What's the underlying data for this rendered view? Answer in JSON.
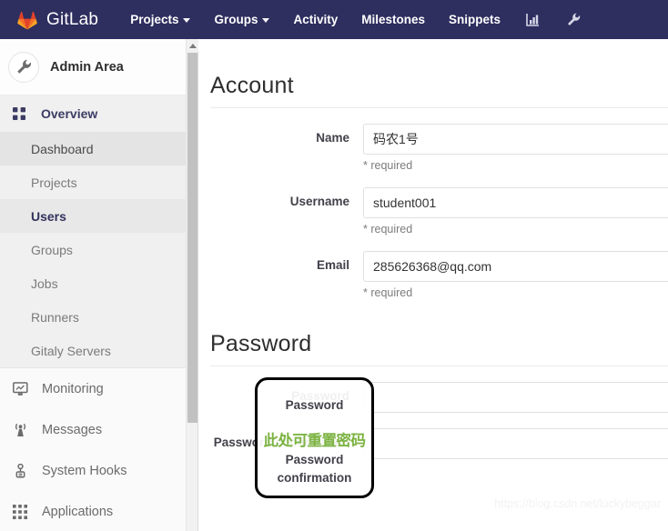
{
  "navbar": {
    "brand": "GitLab",
    "brand_logo_icon": "gitlab-fox-logo-icon",
    "items": [
      {
        "label": "Projects",
        "has_caret": true
      },
      {
        "label": "Groups",
        "has_caret": true
      },
      {
        "label": "Activity",
        "has_caret": false
      },
      {
        "label": "Milestones",
        "has_caret": false
      },
      {
        "label": "Snippets",
        "has_caret": false
      }
    ],
    "icon_buttons": [
      {
        "name": "analytics-chart-icon"
      },
      {
        "name": "wrench-admin-icon"
      }
    ],
    "background_color": "#2e2e5f"
  },
  "sidebar": {
    "header": {
      "title": "Admin Area",
      "avatar_icon": "wrench-icon"
    },
    "overview": {
      "label": "Overview",
      "icon": "grid-dots-icon"
    },
    "sub_items": [
      {
        "label": "Dashboard",
        "state": "hovered"
      },
      {
        "label": "Projects",
        "state": "default"
      },
      {
        "label": "Users",
        "state": "active"
      },
      {
        "label": "Groups",
        "state": "default"
      },
      {
        "label": "Jobs",
        "state": "default"
      },
      {
        "label": "Runners",
        "state": "default"
      },
      {
        "label": "Gitaly Servers",
        "state": "default"
      }
    ],
    "main_items": [
      {
        "label": "Monitoring",
        "icon": "monitor-icon"
      },
      {
        "label": "Messages",
        "icon": "broadcast-antenna-icon"
      },
      {
        "label": "System Hooks",
        "icon": "hook-icon"
      },
      {
        "label": "Applications",
        "icon": "apps-grid-icon"
      }
    ],
    "active_color": "#32325d"
  },
  "scrollbar": {
    "up_arrow_icon": "scroll-up-arrow-icon",
    "thumb_color": "#c1c1c1"
  },
  "content": {
    "account": {
      "heading": "Account",
      "fields": [
        {
          "label": "Name",
          "value": "码农1号",
          "hint": "* required",
          "type": "text"
        },
        {
          "label": "Username",
          "value": "student001",
          "hint": "* required",
          "type": "text"
        },
        {
          "label": "Email",
          "value": "285626368@qq.com",
          "hint": "* required",
          "type": "text"
        }
      ]
    },
    "password": {
      "heading": "Password",
      "fields": [
        {
          "label": "Password",
          "value": "",
          "type": "password"
        },
        {
          "label": "Password confirmation",
          "value": "",
          "type": "password"
        }
      ]
    }
  },
  "annotation": {
    "label_top": "Password",
    "label_bottom_line1": "Password",
    "label_bottom_line2": "confirmation",
    "note_text": "此处可重置密码",
    "note_color": "#7cb342",
    "border_color": "#000000"
  },
  "watermark": {
    "text": "https://blog.csdn.net/luckybeggar"
  }
}
